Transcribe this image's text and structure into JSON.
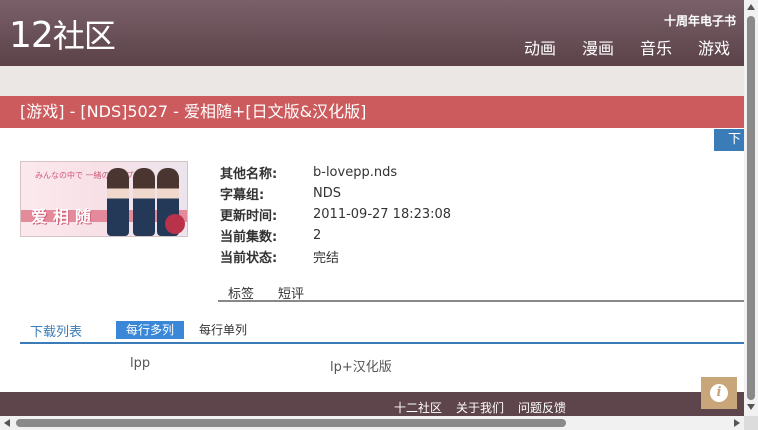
{
  "header": {
    "logo_number": "12",
    "logo_text": "社区",
    "anniversary": "十周年电子书",
    "nav": [
      "动画",
      "漫画",
      "音乐",
      "游戏"
    ]
  },
  "title": "[游戏] - [NDS]5027 - 爱相随+[日文版&汉化版]",
  "download_tab": "下",
  "cover": {
    "big_text": "爱相随",
    "small_text": "みんなの中で 一緒のラブプラス"
  },
  "info": [
    {
      "label": "其他名称:",
      "value": "b-lovepp.nds"
    },
    {
      "label": "字幕组:",
      "value": "NDS"
    },
    {
      "label": "更新时间:",
      "value": "2011-09-27 18:23:08"
    },
    {
      "label": "当前集数:",
      "value": "2"
    },
    {
      "label": "当前状态:",
      "value": "完结"
    }
  ],
  "tabs": [
    "标签",
    "短评"
  ],
  "download": {
    "label": "下载列表",
    "mode_multi": "每行多列",
    "mode_single": "每行单列",
    "files": [
      "lpp",
      "lp+汉化版"
    ]
  },
  "footer": {
    "links": [
      "十二社区",
      "关于我们",
      "问题反馈"
    ]
  },
  "colors": {
    "header": "#6b5259",
    "title_bar": "#cc5b5e",
    "accent": "#3a7cb8",
    "footer": "#5e454c",
    "help": "#c9a57a"
  }
}
